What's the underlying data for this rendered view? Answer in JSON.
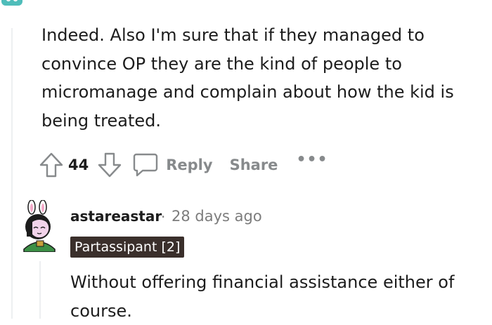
{
  "comment_top": {
    "body": "Indeed. Also I'm sure that if they managed to convince OP they are the kind of people to micromanage and complain about how the kid is being treated.",
    "score": "44",
    "reply_label": "Reply",
    "share_label": "Share",
    "more_label": "•••"
  },
  "comment_reply": {
    "username": "astareastar",
    "separator": "·",
    "timestamp": "28 days ago",
    "flair": "Partassipant [2]",
    "body": "Without offering financial assistance either of course."
  },
  "colors": {
    "text": "#1c1c1c",
    "muted": "#878a8c",
    "flair_bg": "#3a2f2b",
    "thread_line": "#edeff1",
    "avatar_teal": "#4fbdba"
  },
  "icons": [
    "upvote-icon",
    "downvote-icon",
    "comment-icon",
    "more-icon",
    "user-avatar"
  ]
}
